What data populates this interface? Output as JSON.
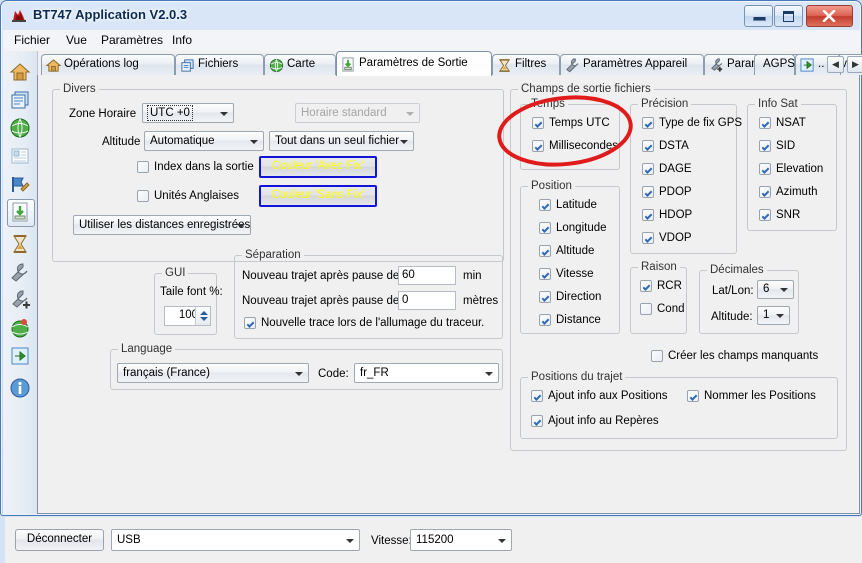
{
  "window": {
    "title": "BT747 Application V2.0.3",
    "icon": "app-icon",
    "controls": {
      "minimize": "–",
      "maximize": "□",
      "close": "✕"
    }
  },
  "menubar": {
    "items": [
      "Fichier",
      "Vue",
      "Paramètres",
      "Info"
    ]
  },
  "rail": {
    "items": [
      {
        "name": "home-icon"
      },
      {
        "name": "files-icon"
      },
      {
        "name": "globe-icon"
      },
      {
        "name": "report-icon"
      },
      {
        "name": "flag-edit-icon"
      },
      {
        "name": "output-settings-icon",
        "selected": true
      },
      {
        "name": "hourglass-filters-icon"
      },
      {
        "name": "wrench-device-icon"
      },
      {
        "name": "wrench-plus-advanced-icon"
      },
      {
        "name": "agps-globe-icon"
      },
      {
        "name": "export-arrow-icon"
      },
      {
        "name": "info-icon"
      }
    ]
  },
  "tabs": {
    "items": [
      {
        "label": "Opérations log",
        "icon": "home-icon",
        "active": false
      },
      {
        "label": "Fichiers",
        "icon": "files-icon",
        "active": false
      },
      {
        "label": "Carte",
        "icon": "globe-icon",
        "active": false
      },
      {
        "label": "Paramètres de Sortie",
        "icon": "output-settings-icon",
        "active": true
      },
      {
        "label": "Filtres",
        "icon": "hourglass-icon",
        "active": false
      },
      {
        "label": "Paramètres Appareil",
        "icon": "wrench-icon",
        "active": false
      },
      {
        "label": "Paramètres Appareil Avancés",
        "icon": "wrench-plus-icon",
        "active": false
      },
      {
        "label": "AGPS",
        "icon": "",
        "active": false
      },
      {
        "label": "..",
        "icon": "export-arrow-icon",
        "active": false
      }
    ],
    "nav_prev": "◀",
    "nav_next": "▶"
  },
  "divers": {
    "title": "Divers",
    "zone_horaire_label": "Zone Horaire",
    "zone_horaire_value": "UTC +0",
    "horaire_standard_value": "Horaire standard",
    "altitude_label": "Altitude",
    "altitude_value": "Automatique",
    "file_mode_value": "Tout dans un seul fichier",
    "index_sortie_label": "Index dans la sortie",
    "index_sortie_checked": false,
    "unites_anglaises_label": "Unités Anglaises",
    "unites_anglaises_checked": false,
    "couleur_avec_fix": "Couleur 'Avec Fix'",
    "couleur_sans_fix": "Couleur 'Sans Fix'",
    "distances_value": "Utiliser les distances enregistrées"
  },
  "gui": {
    "title": "GUI",
    "font_label": "Taile font %:",
    "font_value": "100"
  },
  "separation": {
    "title": "Séparation",
    "row1_label": "Nouveau trajet après pause de",
    "row1_value": "60",
    "row1_unit": "min",
    "row2_label": "Nouveau trajet après pause de",
    "row2_value": "0",
    "row2_unit": "mètres",
    "new_track_label": "Nouvelle trace lors de l'allumage du traceur.",
    "new_track_checked": true
  },
  "language": {
    "title": "Language",
    "value": "français (France)",
    "code_label": "Code:",
    "code_value": "fr_FR"
  },
  "champs": {
    "title": "Champs de sortie fichiers",
    "temps": {
      "title": "Temps",
      "items": [
        {
          "label": "Temps UTC",
          "checked": true
        },
        {
          "label": "Millisecondes",
          "checked": true
        }
      ]
    },
    "position": {
      "title": "Position",
      "items": [
        {
          "label": "Latitude",
          "checked": true
        },
        {
          "label": "Longitude",
          "checked": true
        },
        {
          "label": "Altitude",
          "checked": true
        },
        {
          "label": "Vitesse",
          "checked": true
        },
        {
          "label": "Direction",
          "checked": true
        },
        {
          "label": "Distance",
          "checked": true
        }
      ]
    },
    "precision": {
      "title": "Précision",
      "items": [
        {
          "label": "Type de fix GPS",
          "checked": true
        },
        {
          "label": "DSTA",
          "checked": true
        },
        {
          "label": "DAGE",
          "checked": true
        },
        {
          "label": "PDOP",
          "checked": true
        },
        {
          "label": "HDOP",
          "checked": true
        },
        {
          "label": "VDOP",
          "checked": true
        }
      ]
    },
    "infosat": {
      "title": "Info Sat",
      "items": [
        {
          "label": "NSAT",
          "checked": true
        },
        {
          "label": "SID",
          "checked": true
        },
        {
          "label": "Elevation",
          "checked": true
        },
        {
          "label": "Azimuth",
          "checked": true
        },
        {
          "label": "SNR",
          "checked": true
        }
      ]
    },
    "raison": {
      "title": "Raison",
      "items": [
        {
          "label": "RCR",
          "checked": true
        },
        {
          "label": "Cond",
          "checked": false
        }
      ]
    },
    "decimales": {
      "title": "Décimales",
      "latlon_label": "Lat/Lon:",
      "latlon_value": "6",
      "altitude_label": "Altitude:",
      "altitude_value": "1"
    },
    "creer_champs_label": "Créer les champs manquants",
    "creer_champs_checked": false,
    "positions_trajet": {
      "title": "Positions du trajet",
      "items": [
        {
          "label": "Ajout info aux Positions",
          "checked": true
        },
        {
          "label": "Nommer les Positions",
          "checked": true
        },
        {
          "label": "Ajout info au Repères",
          "checked": true
        }
      ]
    }
  },
  "bottom": {
    "disconnect_label": "Déconnecter",
    "port_value": "USB",
    "speed_label": "Vitesse:",
    "speed_value": "115200"
  },
  "annotation": {
    "shape": "ellipse",
    "color": "#e01b1b"
  }
}
